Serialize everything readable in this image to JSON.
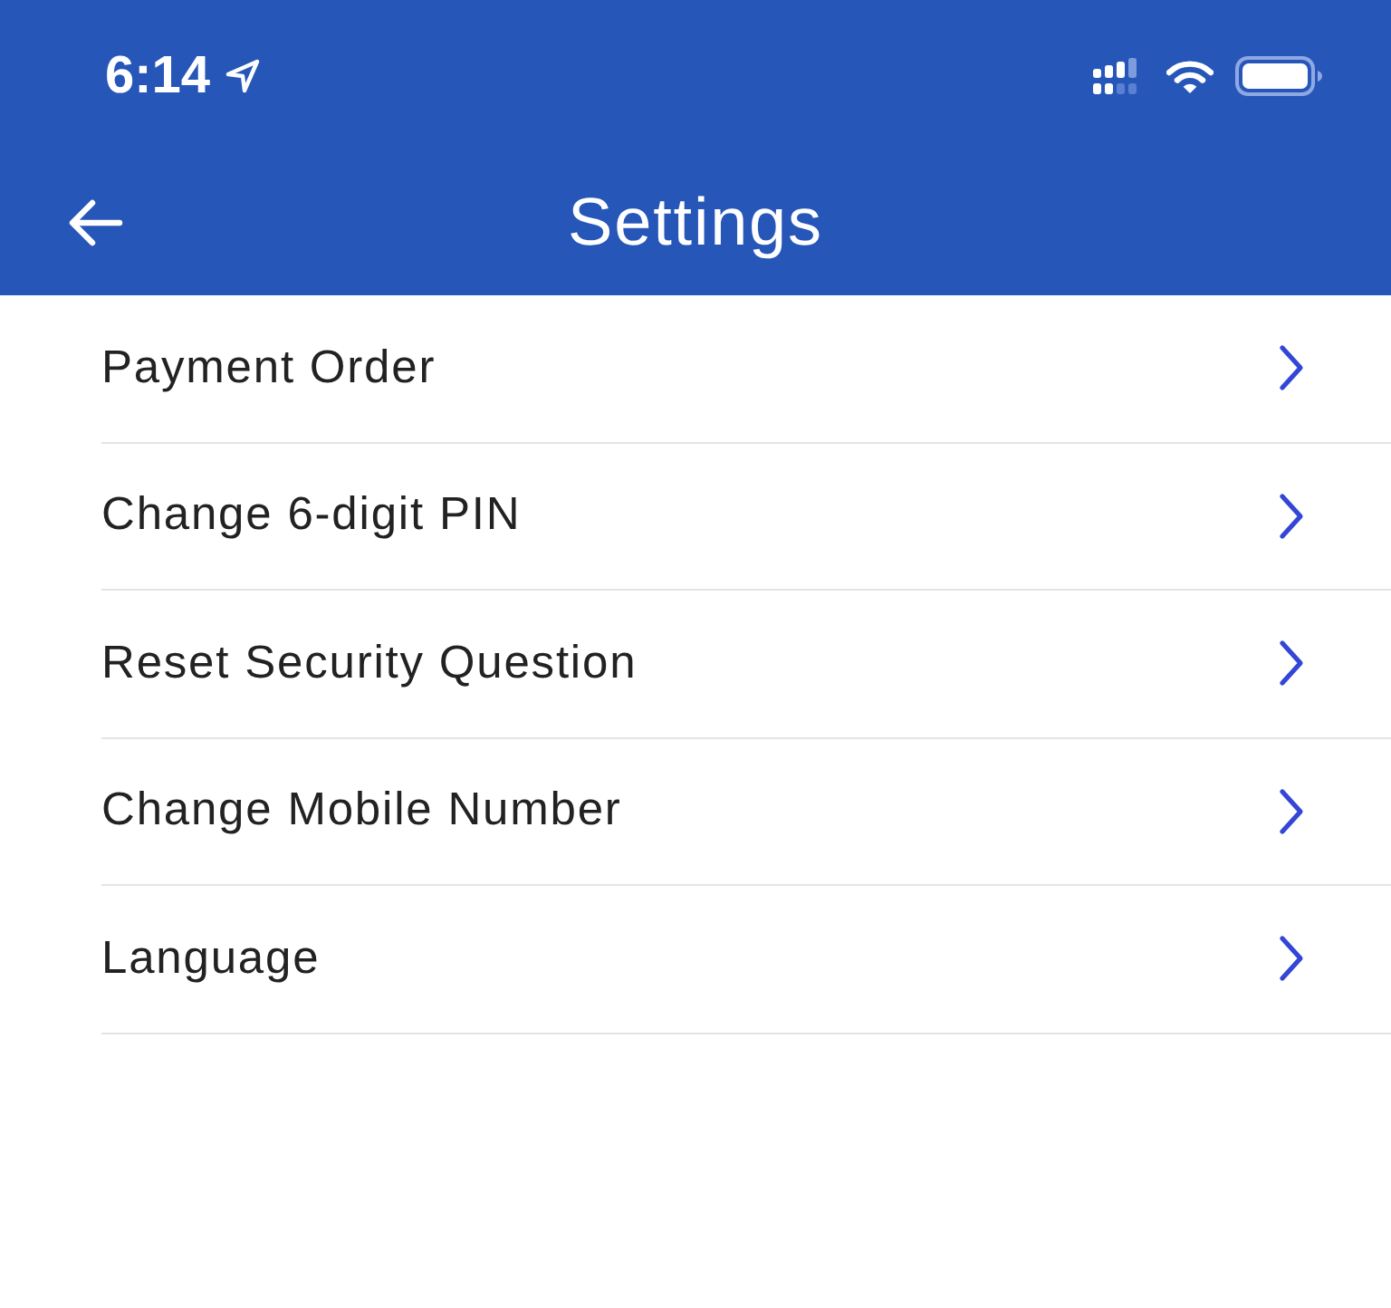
{
  "status_bar": {
    "time": "6:14"
  },
  "header": {
    "title": "Settings"
  },
  "items": [
    {
      "label": "Payment Order"
    },
    {
      "label": "Change 6-digit PIN"
    },
    {
      "label": "Reset Security Question"
    },
    {
      "label": "Change Mobile Number"
    },
    {
      "label": "Language"
    }
  ]
}
